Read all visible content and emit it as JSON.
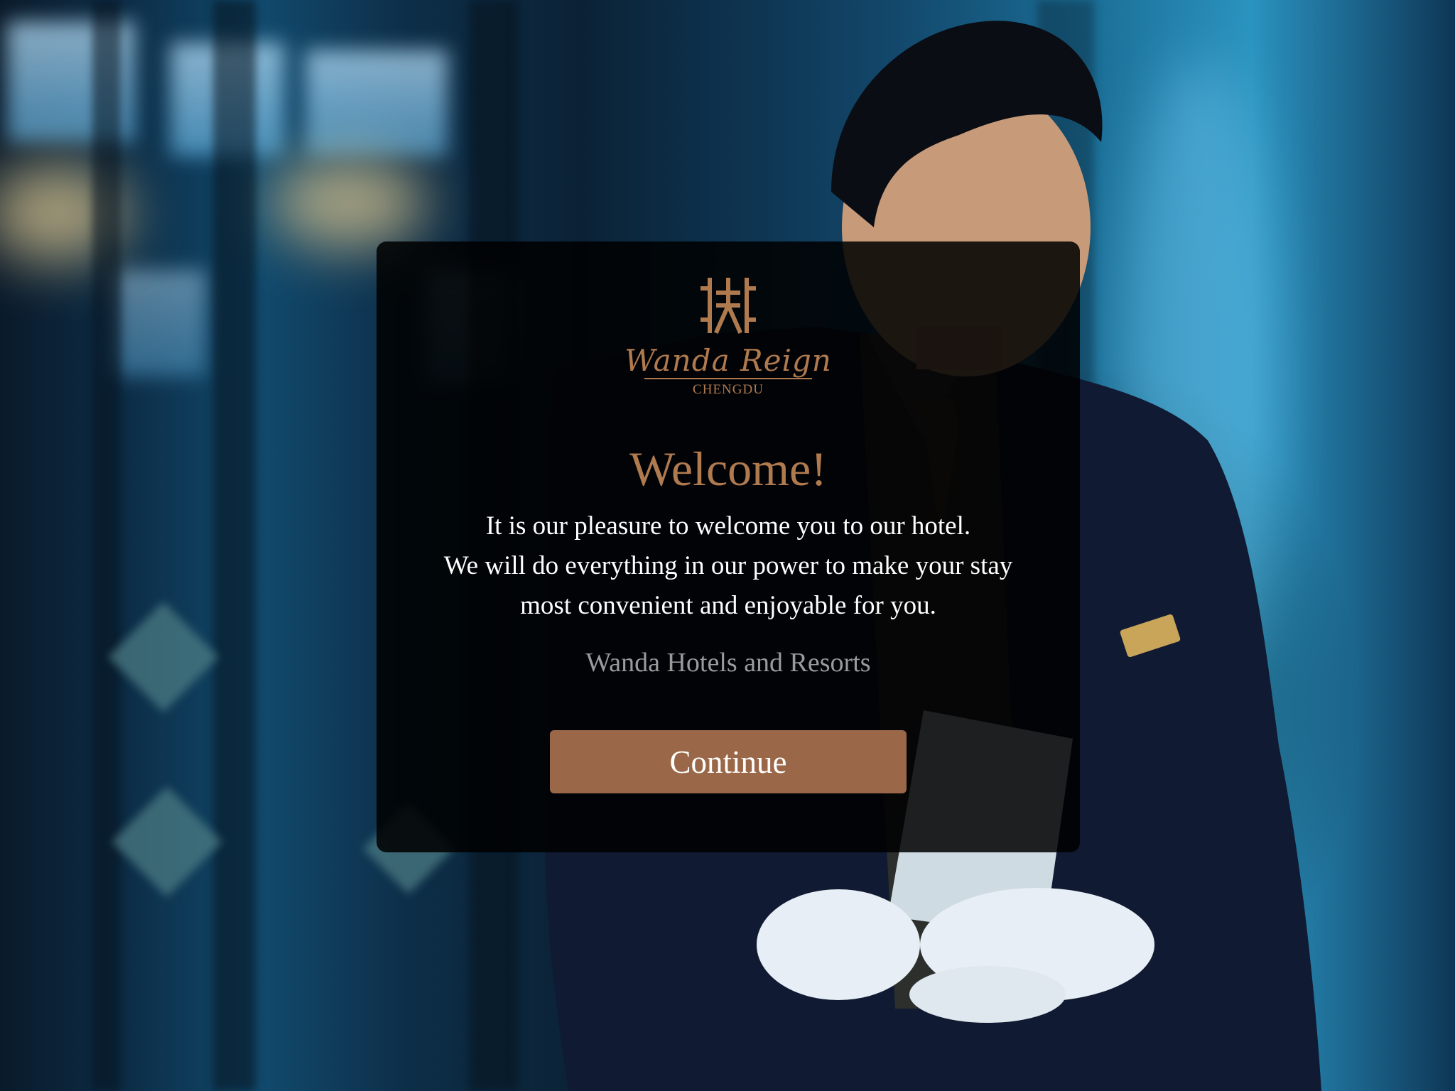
{
  "colors": {
    "brand": "#b07a4f",
    "button": "#9a6848",
    "text_primary": "#ffffff",
    "text_muted": "#9a9a9a",
    "modal_background": "rgba(0,0,0,0.86)"
  },
  "brand": {
    "icon": "wanda-reign-logo-icon",
    "name": "Wanda Reign",
    "city": "CHENGDU"
  },
  "welcome": {
    "title": "Welcome!",
    "lines": [
      "It is our pleasure to welcome you to our hotel.",
      "We will do everything in our power to make your stay",
      "most convenient and enjoyable for you."
    ],
    "signature": "Wanda Hotels and Resorts"
  },
  "actions": {
    "continue_label": "Continue"
  }
}
